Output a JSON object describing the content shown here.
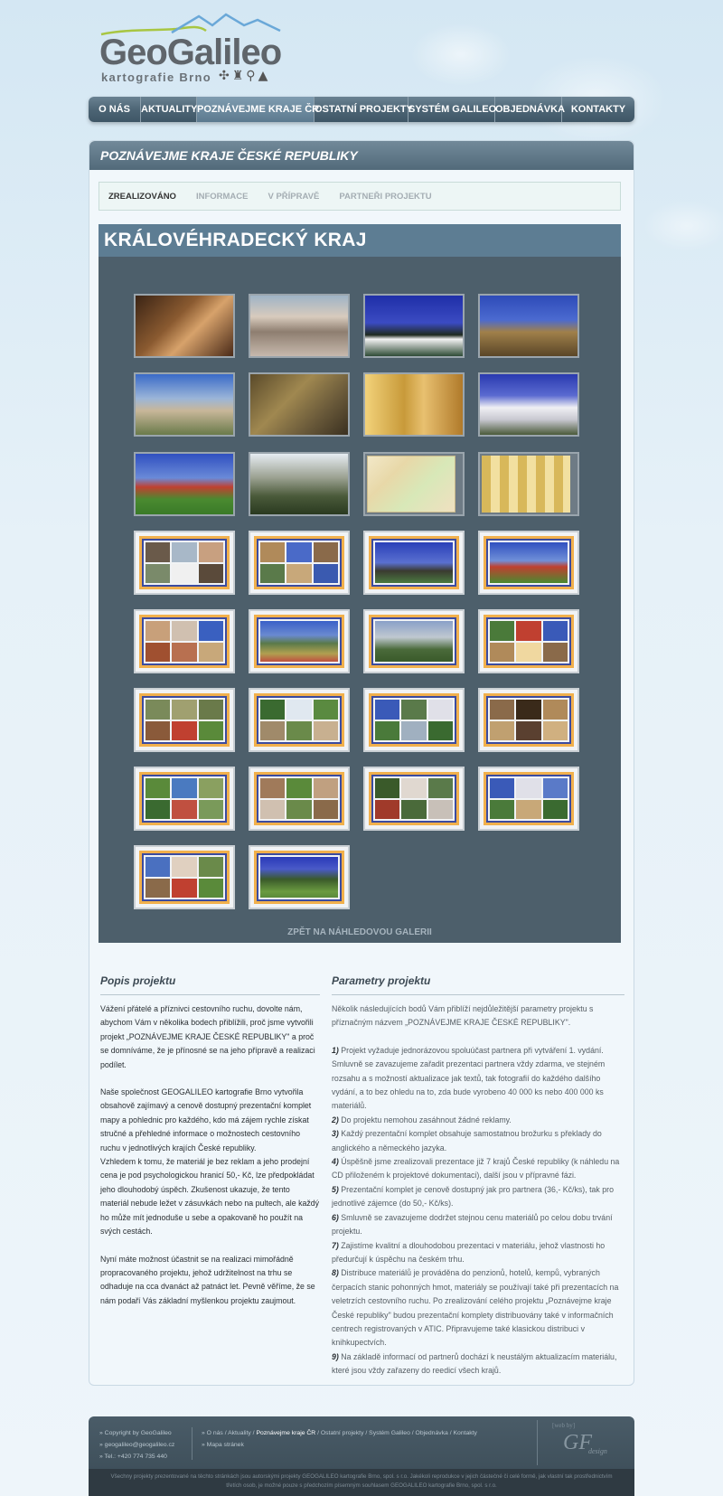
{
  "logo": {
    "title": "GeoGalileo",
    "subtitle": "kartografie Brno",
    "icons": [
      "footprints-icon",
      "castle-icon",
      "bicycle-icon",
      "mountain-icon"
    ]
  },
  "nav": [
    {
      "label": "O NÁS"
    },
    {
      "label": "AKTUALITY"
    },
    {
      "label": "POZNÁVEJME KRAJE ČR",
      "active": true
    },
    {
      "label": "OSTATNÍ PROJEKTY"
    },
    {
      "label": "SYSTÉM GALILEO"
    },
    {
      "label": "OBJEDNÁVKA"
    },
    {
      "label": "KONTAKTY"
    }
  ],
  "page": {
    "title": "POZNÁVEJME KRAJE ČESKÉ REPUBLIKY"
  },
  "subtabs": [
    {
      "label": "ZREALIZOVÁNO",
      "active": true
    },
    {
      "label": "INFORMACE"
    },
    {
      "label": "V PŘÍPRAVĚ"
    },
    {
      "label": "PARTNEŘI PROJEKTU"
    }
  ],
  "gallery": {
    "title": "KRÁLOVÉHRADECKÝ KRAJ",
    "back_label": "ZPĚT NA NÁHLEDOVOU GALERII"
  },
  "left_col": {
    "heading": "Popis projektu",
    "p1": "Vážení přátelé a příznivci cestovního ruchu, dovolte nám, abychom Vám v několika bodech přiblížili, proč jsme vytvořili projekt „POZNÁVEJME KRAJE ČESKÉ REPUBLIKY\" a proč se domníváme, že je přínosné se na jeho přípravě a realizaci podílet.",
    "p2": "Naše společnost GEOGALILEO kartografie Brno vytvořila obsahově zajímavý a cenově dostupný prezentační komplet mapy a pohlednic pro každého, kdo má zájem rychle získat stručné a přehledné informace o možnostech cestovního ruchu v jednotlivých krajích České republiky.",
    "p3": "Vzhledem k tomu, že materiál je bez reklam a jeho prodejní cena je pod psychologickou hranicí 50,- Kč, lze předpokládat jeho dlouhodobý úspěch. Zkušenost ukazuje, že tento materiál nebude ležet v zásuvkách nebo na pultech, ale každý ho může mít jednoduše u sebe a opakovaně ho použít na svých cestách.",
    "p4": "Nyní máte možnost účastnit se na realizaci mimořádně propracovaného projektu, jehož udržitelnost na trhu se odhaduje na cca dvanáct až patnáct let. Pevně věříme, že se nám podaří Vás základní myšlenkou projektu zaujmout."
  },
  "right_col": {
    "heading": "Parametry projektu",
    "intro": "Několik následujících bodů Vám přiblíží nejdůležitější parametry projektu s příznačným názvem „POZNÁVEJME KRAJE ČESKÉ REPUBLIKY\".",
    "points": [
      {
        "n": "1)",
        "t": "Projekt vyžaduje jednorázovou spoluúčast partnera při vytváření 1. vydání. Smluvně se zavazujeme zařadit prezentaci partnera vždy zdarma, ve stejném rozsahu a s možností aktualizace jak textů, tak fotografií do každého dalšího vydání, a to bez ohledu na to, zda bude vyrobeno 40 000 ks nebo 400 000 ks materiálů."
      },
      {
        "n": "2)",
        "t": "Do projektu nemohou zasáhnout žádné reklamy."
      },
      {
        "n": "3)",
        "t": "Každý prezentační komplet obsahuje samostatnou brožurku s překlady do anglického a německého jazyka."
      },
      {
        "n": "4)",
        "t": "Úspěšně jsme zrealizovali prezentace již 7 krajů České republiky (k náhledu na CD přiloženém k projektové dokumentaci), další jsou v přípravné fázi."
      },
      {
        "n": "5)",
        "t": "Prezentační komplet je cenově dostupný jak pro partnera (36,- Kč/ks), tak pro jednotlivé zájemce (do 50,- Kč/ks)."
      },
      {
        "n": "6)",
        "t": "Smluvně se zavazujeme dodržet stejnou cenu materiálů po celou dobu trvání projektu."
      },
      {
        "n": "7)",
        "t": "Zajistíme kvalitní a dlouhodobou prezentaci v materiálu, jehož vlastnosti ho předurčují k úspěchu na českém trhu."
      },
      {
        "n": "8)",
        "t": "Distribuce materiálů je prováděna do penzionů, hotelů, kempů, vybraných čerpacích stanic pohonných hmot, materiály se používají také při prezentacích na veletrzích cestovního ruchu. Po zrealizování celého projektu „Poznávejme kraje České republiky\" budou prezentační komplety distribuovány také v informačních centrech registrovaných v ATIC. Připravujeme také klasickou distribuci v knihkupectvích."
      },
      {
        "n": "9)",
        "t": "Na základě informací od partnerů dochází k neustálým aktualizacím materiálu, které jsou vždy zařazeny do reedicí všech krajů."
      }
    ]
  },
  "footer": {
    "copyright": "» Copyright by GeoGalileo",
    "email": "» geogalileo@geogalileo.cz",
    "phone": "» Tel.: +420 774 735 440",
    "links_line": [
      "O nás",
      "Aktuality",
      "Poznávejme kraje ČR",
      "Ostatní projekty",
      "Systém Galileo",
      "Objednávka",
      "Kontakty"
    ],
    "sitemap": "» Mapa stránek",
    "web_by": "[web by]",
    "designer_logo": "GF",
    "designer_sub": "design",
    "legal": "Všechny projekty prezentované na těchto stránkách jsou autorskými projekty GEOGALILEO kartografie Brno, spol. s r.o. Jakékoli reprodukce v jejich částečné či celé formě, jak vlastní tak prostřednictvím třetích osob, je možné pouze s předchozím písemným souhlasem GEOGALILEO kartografie Brno, spol. s r.o."
  },
  "colors": {
    "accent": "#5d7d93",
    "nav": "#4b6373",
    "gallery_bg": "#4d5f6b",
    "frame_orange": "#f1b04c",
    "frame_blue": "#3b4ba0"
  }
}
